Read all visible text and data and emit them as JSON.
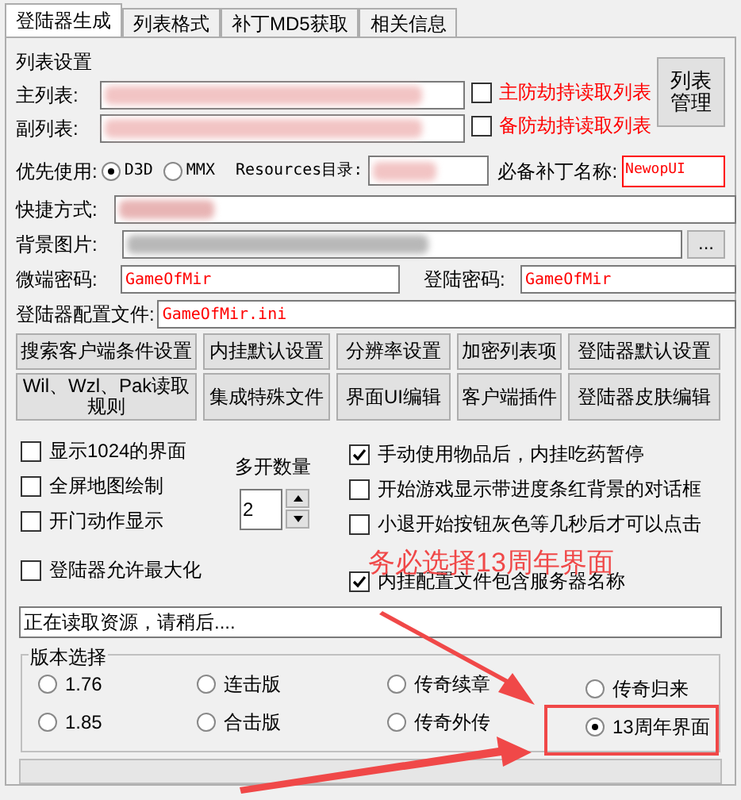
{
  "tabs": [
    {
      "label": "登陆器生成",
      "selected": true
    },
    {
      "label": "列表格式",
      "selected": false
    },
    {
      "label": "补丁MD5获取",
      "selected": false
    },
    {
      "label": "相关信息",
      "selected": false
    }
  ],
  "list_settings": {
    "title": "列表设置",
    "main_label": "主列表:",
    "sub_label": "副列表:",
    "anti_hijack": [
      {
        "label": "主防劫持读取列表",
        "checked": false
      },
      {
        "label": "备防劫持读取列表",
        "checked": false
      }
    ],
    "manage_button": "列表管理"
  },
  "priority": {
    "label": "优先使用:",
    "options": [
      {
        "label": "D3D",
        "selected": true
      },
      {
        "label": "MMX",
        "selected": false
      }
    ],
    "resources_label": "Resources目录:",
    "patch_label": "必备补丁名称:",
    "patch_value": "NewopUI"
  },
  "shortcut": {
    "label": "快捷方式:"
  },
  "background": {
    "label": "背景图片:",
    "browse_button": "..."
  },
  "micro_password": {
    "label": "微端密码:",
    "value": "GameOfMir"
  },
  "login_password": {
    "label": "登陆密码:",
    "value": "GameOfMir"
  },
  "config_file": {
    "label": "登陆器配置文件:",
    "value": "GameOfMir.ini"
  },
  "buttons": [
    "搜索客户端条件设置",
    "内挂默认设置",
    "分辨率设置",
    "加密列表项",
    "登陆器默认设置",
    "Wil、Wzl、Pak读取规则",
    "集成特殊文件",
    "界面UI编辑",
    "客户端插件",
    "登陆器皮肤编辑"
  ],
  "left_options": [
    {
      "label": "显示1024的界面",
      "checked": false
    },
    {
      "label": "全屏地图绘制",
      "checked": false
    },
    {
      "label": "开门动作显示",
      "checked": false
    },
    {
      "label": "登陆器允许最大化",
      "checked": false
    }
  ],
  "multi_open": {
    "label": "多开数量",
    "value": "2"
  },
  "right_options": [
    {
      "label": "手动使用物品后，内挂吃药暂停",
      "checked": true
    },
    {
      "label": "开始游戏显示带进度条红背景的对话框",
      "checked": false
    },
    {
      "label": "小退开始按钮灰色等几秒后才可以点击",
      "checked": false
    },
    {
      "label": "内挂配置文件包含服务器名称",
      "checked": true
    }
  ],
  "status": "正在读取资源，请稍后....",
  "version": {
    "title": "版本选择",
    "options": [
      {
        "label": "1.76",
        "selected": false
      },
      {
        "label": "连击版",
        "selected": false
      },
      {
        "label": "传奇续章",
        "selected": false
      },
      {
        "label": "传奇归来",
        "selected": false
      },
      {
        "label": "1.85",
        "selected": false
      },
      {
        "label": "合击版",
        "selected": false
      },
      {
        "label": "传奇外传",
        "selected": false
      },
      {
        "label": "13周年界面",
        "selected": true
      }
    ]
  },
  "annotation": "务必选择13周年界面"
}
